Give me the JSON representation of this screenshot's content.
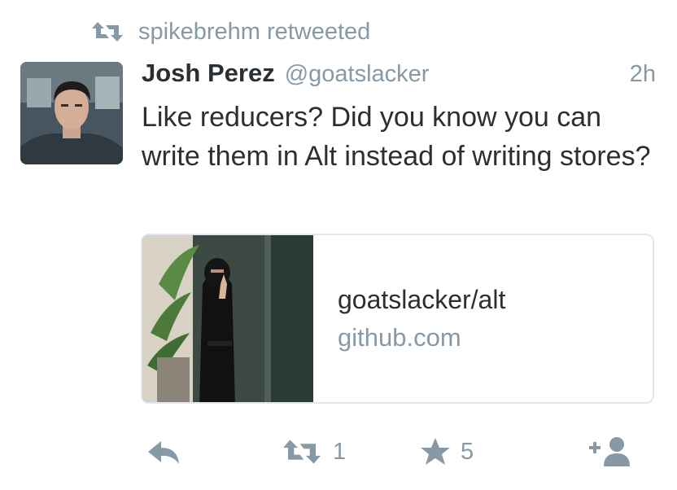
{
  "retweet": {
    "icon": "retweet-icon",
    "text": "spikebrehm retweeted"
  },
  "tweet": {
    "author_name": "Josh Perez",
    "author_handle": "@goatslacker",
    "timestamp": "2h",
    "avatar": "avatar-photo",
    "text": "Like reducers? Did you know you can write them in Alt instead of writing stores?"
  },
  "card": {
    "title": "goatslacker/alt",
    "domain": "github.com",
    "image": "card-thumbnail-photo"
  },
  "actions": {
    "reply_icon": "reply-icon",
    "retweet_icon": "retweet-icon",
    "retweet_count": "1",
    "favorite_icon": "star-icon",
    "favorite_count": "5",
    "follow_icon": "follow-user-icon"
  },
  "colors": {
    "text": "#292f33",
    "muted": "#8899a6",
    "border": "#e1e8ed"
  }
}
